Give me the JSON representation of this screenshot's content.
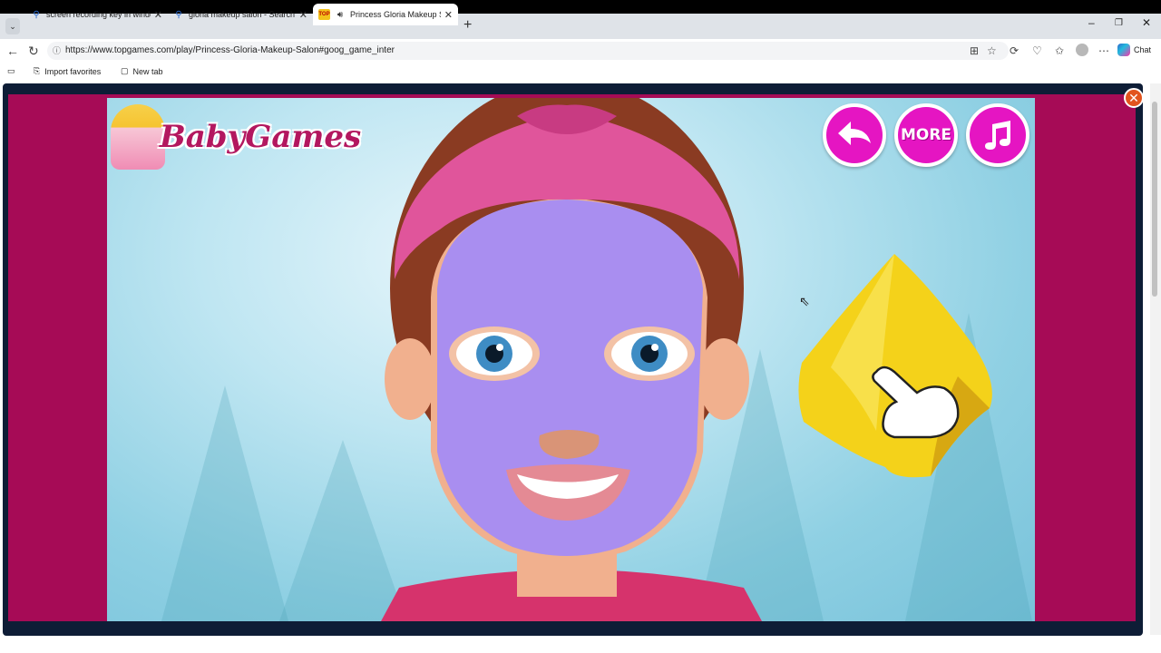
{
  "browser": {
    "tabs": [
      {
        "title": "screen recording key in windows",
        "icon": "search-icon",
        "active": false
      },
      {
        "title": "gloria makeup salon - Search",
        "icon": "search-icon",
        "active": false
      },
      {
        "title": "Princess Gloria Makeup Salon",
        "icon": "topgames-favicon",
        "active": true,
        "audio": true
      }
    ],
    "url": "https://www.topgames.com/play/Princess-Gloria-Makeup-Salon#goog_game_inter",
    "chat_label": "Chat",
    "favorites": [
      {
        "label": "Import favorites",
        "icon": "import-icon"
      },
      {
        "label": "New tab",
        "icon": "page-icon"
      }
    ]
  },
  "game": {
    "logo_text": "BabyGames",
    "buttons": {
      "back_icon": "back-arrow-icon",
      "more_label": "MORE",
      "music_icon": "music-note-icon"
    },
    "tool": "towel",
    "colors": {
      "frame_border": "#a60b56",
      "button_fill": "#e515c2",
      "mask": "#a98ef0",
      "headband": "#e0559b",
      "towel": "#f4d21a",
      "close_button": "#e2541e"
    }
  }
}
